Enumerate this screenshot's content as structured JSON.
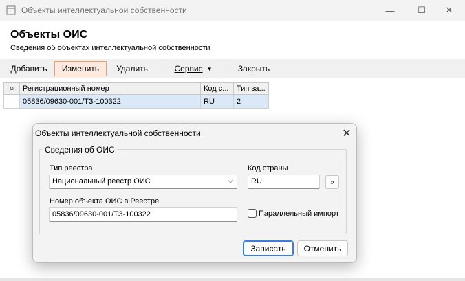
{
  "window": {
    "title": "Объекты интеллектуальной собственности",
    "minimize_glyph": "—",
    "maximize_glyph": "☐",
    "close_glyph": "✕"
  },
  "header": {
    "title": "Объекты ОИС",
    "subtitle": "Сведения об объектах интеллектуальной собственности"
  },
  "toolbar": {
    "add_label": "Добавить",
    "edit_label": "Изменить",
    "delete_label": "Удалить",
    "service_label": "Сервис",
    "service_caret": "▼",
    "close_label": "Закрыть"
  },
  "grid": {
    "marker_header": "¤",
    "columns": [
      "Регистрационный номер",
      "Код с...",
      "Тип за..."
    ],
    "rows": [
      {
        "marker": "",
        "reg_number": "05836/09630-001/ТЗ-100322",
        "country": "RU",
        "type": "2"
      }
    ]
  },
  "dialog": {
    "title": "Объекты интеллектуальной собственности",
    "close_glyph": "✕",
    "group_title": "Сведения об ОИС",
    "registry_type_label": "Тип реестра",
    "registry_type_value": "Национальный реестр ОИС",
    "registry_caret": "⌵",
    "country_code_label": "Код страны",
    "country_code_value": "RU",
    "lookup_button": "»",
    "object_number_label": "Номер объекта ОИС в Реестре",
    "object_number_value": "05836/09630-001/ТЗ-100322",
    "parallel_import_label": "Параллельный импорт",
    "parallel_import_checked": false,
    "save_button": "Записать",
    "cancel_button": "Отменить"
  },
  "colors": {
    "selected_row": "#dbe8f7",
    "active_toolbar_border": "#e8a070",
    "primary_button_border": "#3b7ddd"
  }
}
